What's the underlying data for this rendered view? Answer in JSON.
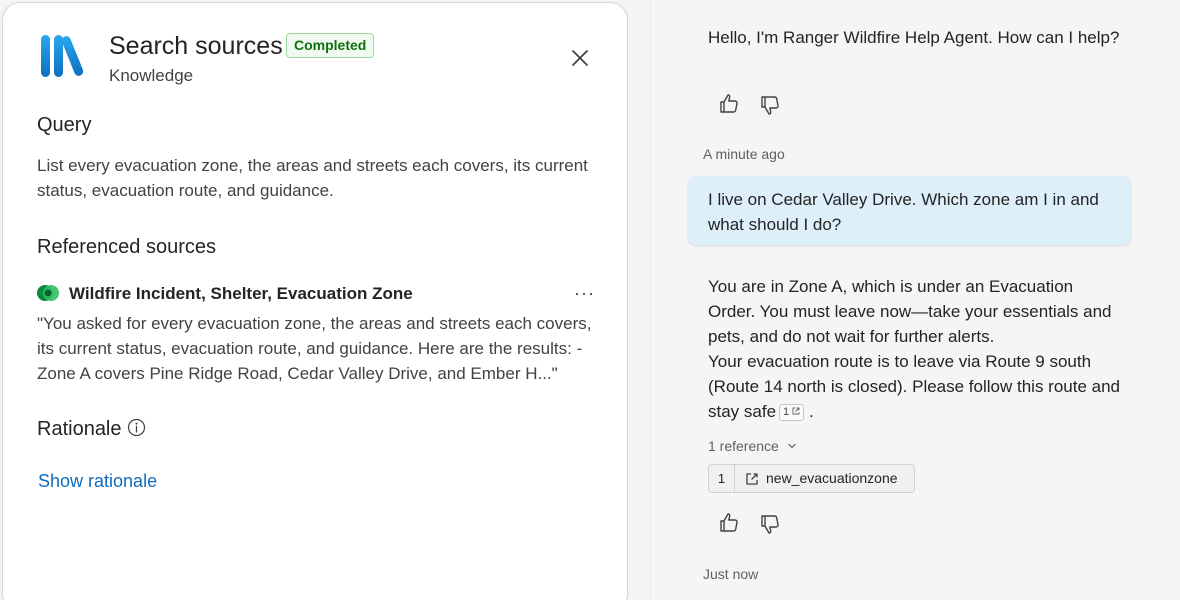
{
  "panel": {
    "title": "Search sources",
    "status_badge": "Completed",
    "subtitle": "Knowledge",
    "query_heading": "Query",
    "query_text": "List every evacuation zone, the areas and streets each covers, its current status, evacuation route, and guidance.",
    "sources_heading": "Referenced sources",
    "source": {
      "name": "Wildfire Incident, Shelter, Evacuation Zone",
      "more_label": "···",
      "excerpt": "\"You asked for every evacuation zone, the areas and streets each covers, its current status, evacuation route, and guidance. Here are the results: - Zone A covers Pine Ridge Road, Cedar Valley Drive, and Ember H...\""
    },
    "rationale_heading": "Rationale",
    "show_rationale_label": "Show rationale"
  },
  "chat": {
    "greeting": "Hello, I'm Ranger Wildfire Help Agent. How can I help?",
    "greeting_time": "A minute ago",
    "user_message": "I live on Cedar Valley Drive. Which zone am I in and what should I do?",
    "answer_p1": "You are in Zone A, which is under an Evacuation Order. You must leave now—take your essentials and pets, and do not wait for further alerts.",
    "answer_p2": "Your evacuation route is to leave via Route 9 south (Route 14 north is closed). Please follow this route and stay safe",
    "citation_marker": "1",
    "answer_end": " .",
    "reference_toggle": "1 reference",
    "reference": {
      "number": "1",
      "name": "new_evacuationzone"
    },
    "answer_time": "Just now"
  },
  "colors": {
    "accent_link": "#0f6cbd",
    "badge_green": "#0e700e",
    "user_bubble": "#ddf0fa",
    "logo_blue": "#1f8fd8"
  }
}
